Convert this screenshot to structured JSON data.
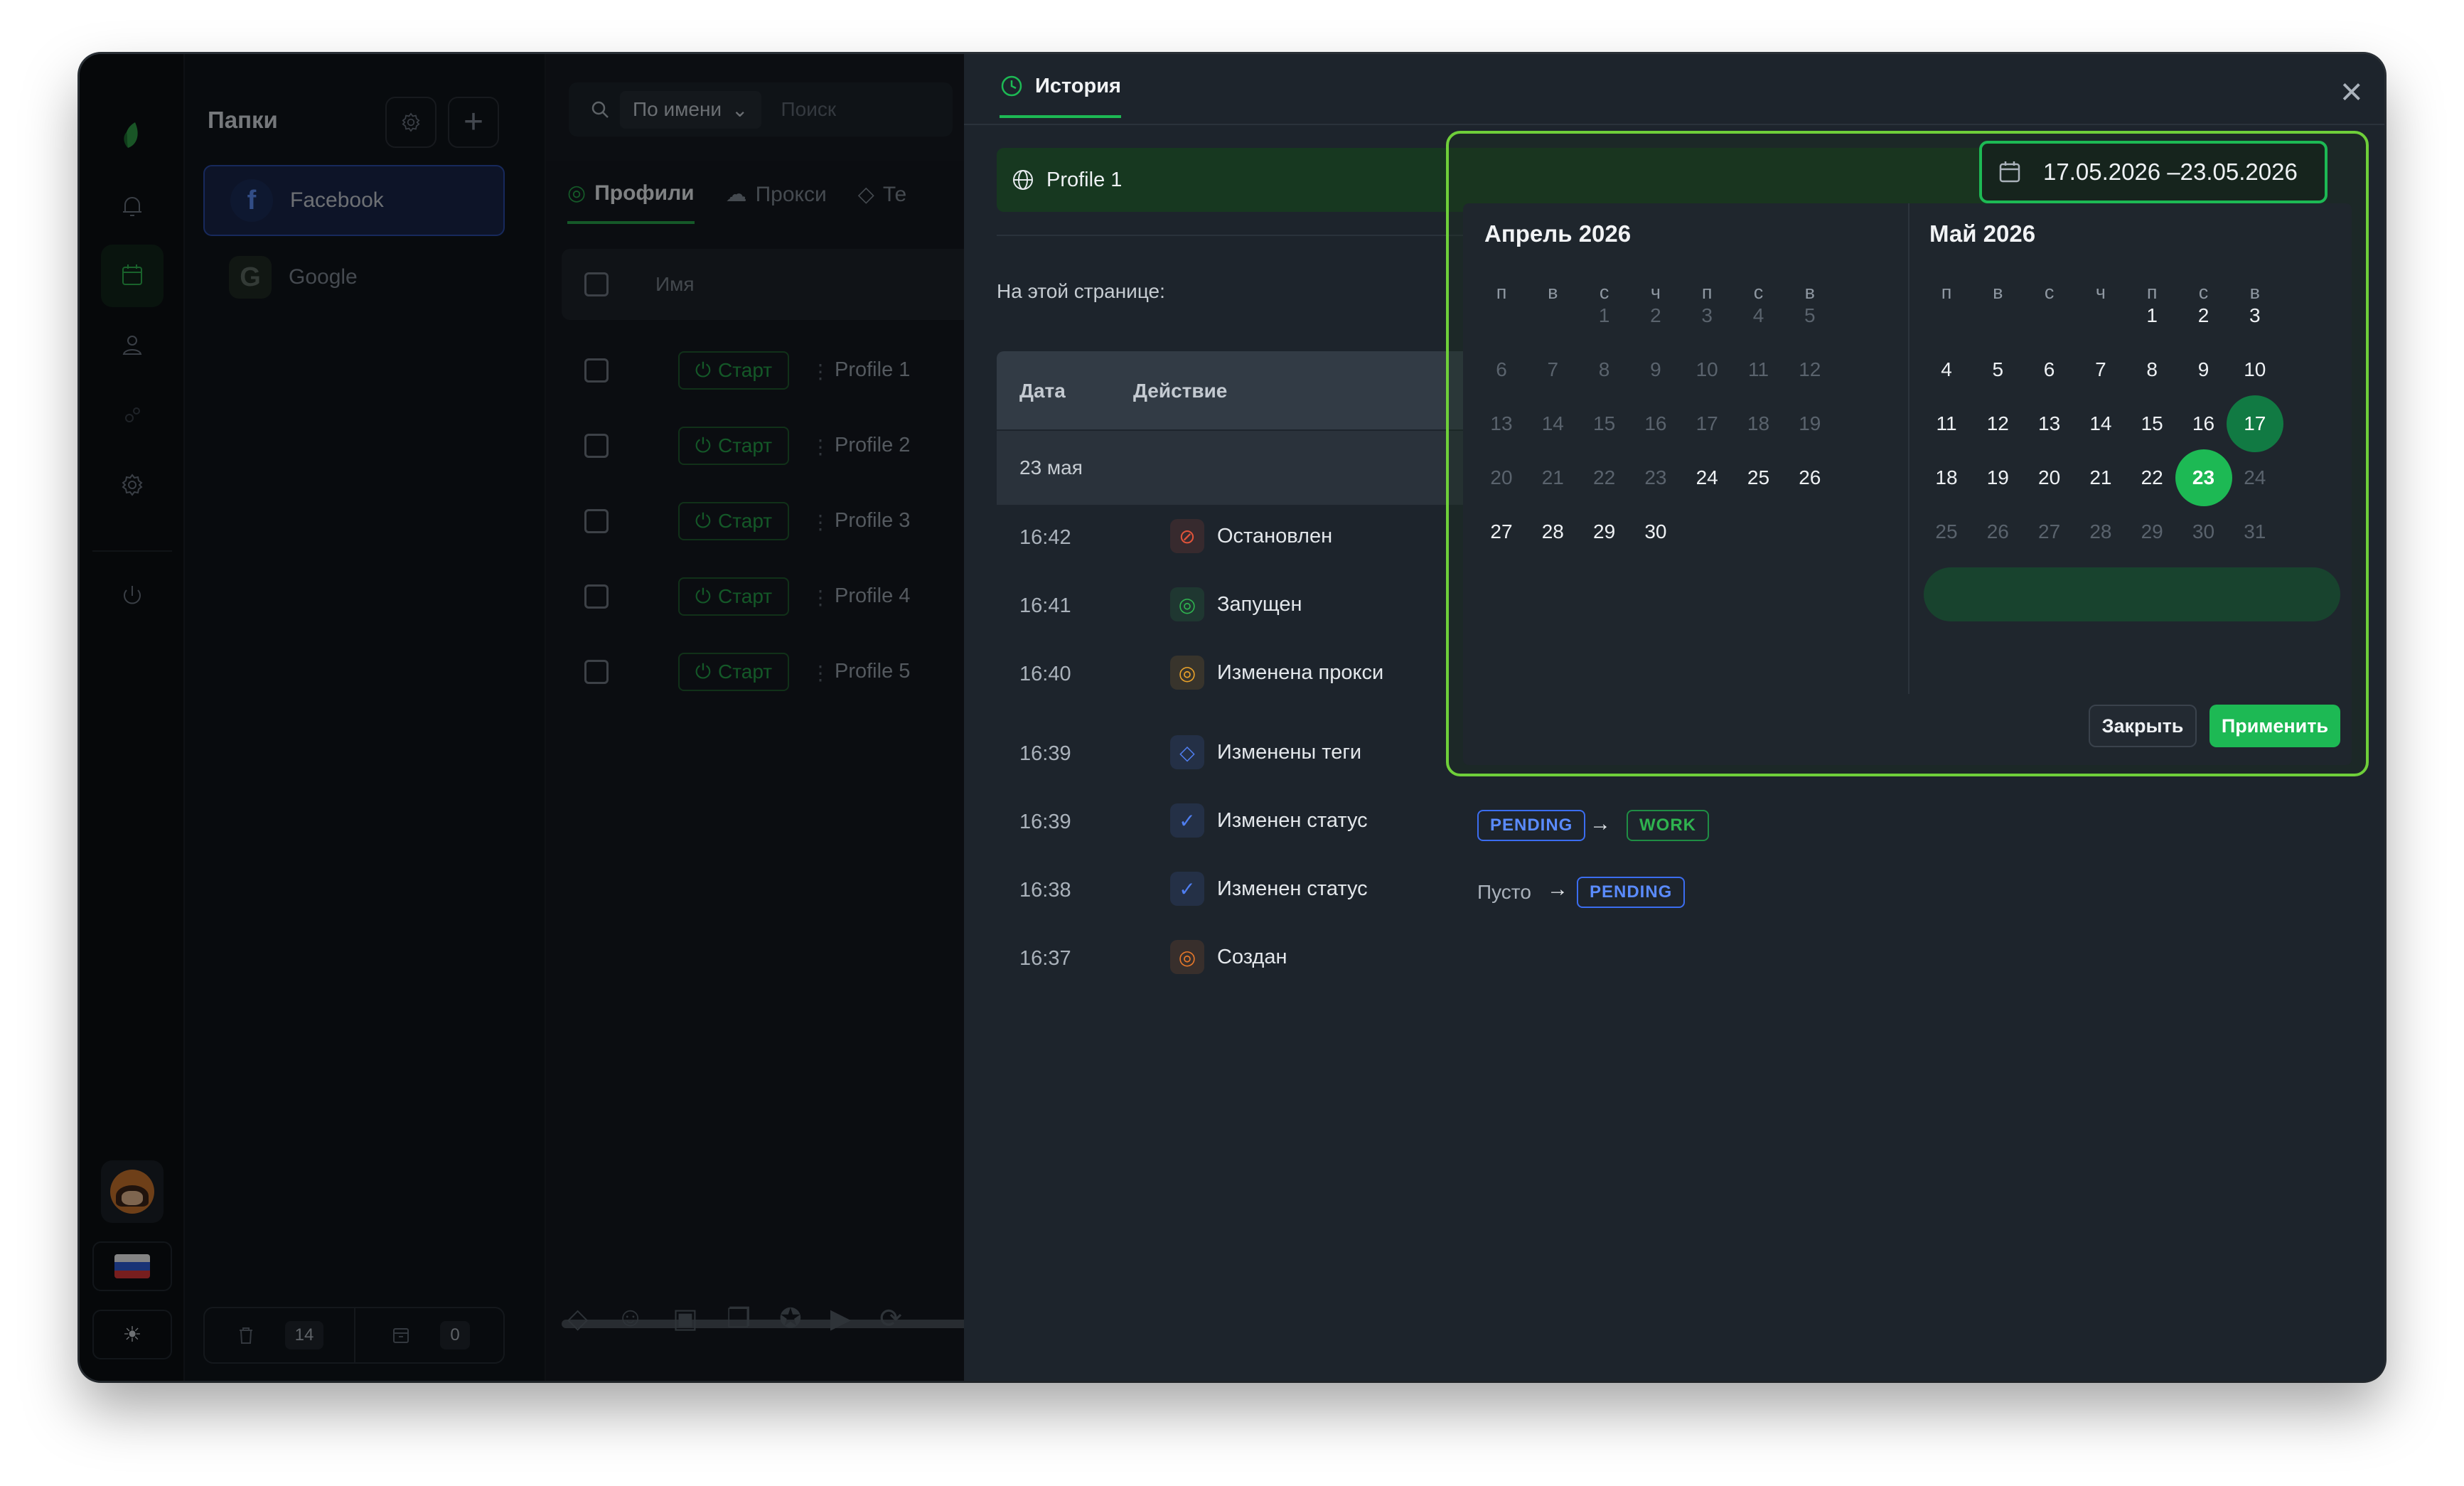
{
  "rail": {
    "icons": [
      "logo-icon",
      "bell-icon",
      "calendar-icon",
      "user-icon",
      "gears-icon",
      "settings-icon",
      "power-icon"
    ],
    "flag": "RU"
  },
  "folders": {
    "title": "Папки",
    "items": [
      {
        "label": "Facebook",
        "letter": "f"
      },
      {
        "label": "Google",
        "letter": "G"
      }
    ],
    "trash_count": "14",
    "archive_count": "0"
  },
  "main": {
    "search_mode": "По имени",
    "search_placeholder": "Поиск",
    "tabs": [
      "Профили",
      "Прокси",
      "Те"
    ],
    "col_name": "Имя",
    "start_label": "Старт",
    "profiles": [
      "Profile 1",
      "Profile 2",
      "Profile 3",
      "Profile 4",
      "Profile 5"
    ]
  },
  "history": {
    "tab": "История",
    "profile": "Profile 1",
    "on_page": "На этой странице:",
    "col_date": "Дата",
    "col_action": "Действие",
    "day": "23 мая",
    "rows": [
      {
        "time": "16:42",
        "action": "Остановлен",
        "icon": "globe-stop-icon",
        "color": "#e0533a"
      },
      {
        "time": "16:41",
        "action": "Запущен",
        "icon": "globe-icon",
        "color": "#2fb34f"
      },
      {
        "time": "16:40",
        "action": "Изменена прокси",
        "icon": "globe-icon",
        "color": "#e8a12a"
      },
      {
        "time": "16:39",
        "action": "Изменены теги",
        "icon": "tag-icon",
        "color": "#4f7ef0"
      },
      {
        "time": "16:39",
        "action": "Изменен статус",
        "icon": "check-circle-icon",
        "color": "#4f7ef0"
      },
      {
        "time": "16:38",
        "action": "Изменен статус",
        "icon": "check-circle-icon",
        "color": "#4f7ef0"
      },
      {
        "time": "16:37",
        "action": "Создан",
        "icon": "globe-icon",
        "color": "#e8782a"
      }
    ],
    "status_change_1": {
      "from": "PENDING",
      "to": "WORK"
    },
    "status_change_2": {
      "from": "Пусто",
      "to": "PENDING"
    }
  },
  "datepicker": {
    "range": "17.05.2026 –23.05.2026",
    "weekdays": [
      "п",
      "в",
      "с",
      "ч",
      "п",
      "с",
      "в"
    ],
    "left_month": "Апрель 2026",
    "right_month": "Май 2026",
    "close_label": "Закрыть",
    "apply_label": "Применить",
    "accent": "#1db954"
  }
}
